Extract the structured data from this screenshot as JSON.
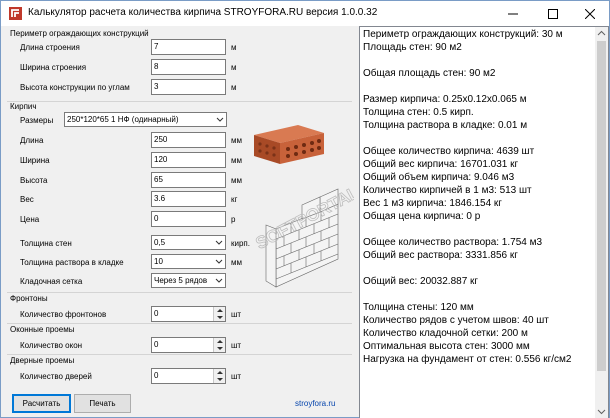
{
  "window": {
    "title": "Калькулятор расчета количества кирпича STROYFORA.RU версия 1.0.0.32"
  },
  "perimeter": {
    "title": "Периметр ограждающих конструкций",
    "fields": [
      {
        "label": "Длина строения",
        "value": "7",
        "unit": "м"
      },
      {
        "label": "Ширина строения",
        "value": "8",
        "unit": "м"
      },
      {
        "label": "Высота конструкции по углам",
        "value": "3",
        "unit": "м"
      }
    ]
  },
  "brick": {
    "title": "Кирпич",
    "size_label": "Размеры",
    "size_value": "250*120*65 1 НФ (одинарный)",
    "fields": [
      {
        "label": "Длина",
        "value": "250",
        "unit": "мм"
      },
      {
        "label": "Ширина",
        "value": "120",
        "unit": "мм"
      },
      {
        "label": "Высота",
        "value": "65",
        "unit": "мм"
      },
      {
        "label": "Вес",
        "value": "3.6",
        "unit": "кг"
      },
      {
        "label": "Цена",
        "value": "0",
        "unit": "р"
      }
    ],
    "wall_thickness": {
      "label": "Толщина стен",
      "value": "0,5",
      "unit": "кирп."
    },
    "mortar_thickness": {
      "label": "Толщина раствора в кладке",
      "value": "10",
      "unit": "мм"
    },
    "mesh": {
      "label": "Кладочная сетка",
      "value": "Через 5 рядов"
    }
  },
  "gables": {
    "title": "Фронтоны",
    "label": "Количество фронтонов",
    "value": "0",
    "unit": "шт"
  },
  "windows": {
    "title": "Оконные проемы",
    "label": "Количество окон",
    "value": "0",
    "unit": "шт"
  },
  "doors": {
    "title": "Дверные проемы",
    "label": "Количество дверей",
    "value": "0",
    "unit": "шт"
  },
  "actions": {
    "calculate": "Расчитать",
    "print": "Печать",
    "site_link": "stroyfora.ru"
  },
  "results": {
    "text": "Периметр ограждающих конструкций: 30 м\nПлощадь стен: 90 м2\n\nОбщая площадь стен: 90 м2\n\nРазмер кирпича: 0.25x0.12x0.065 м\nТолщина стен: 0.5 кирп.\nТолщина раствора в кладке: 0.01 м\n\nОбщее количество кирпича: 4639 шт\nОбщий вес кирпича: 16701.031 кг\nОбщий объем кирпича: 9.046 м3\nКоличество кирпичей в 1 м3: 513 шт\nВес 1 м3 кирпича: 1846.154 кг\nОбщая цена кирпича: 0 р\n\nОбщее количество раствора: 1.754 м3\nОбщий вес раствора: 3331.856 кг\n\nОбщий вес: 20032.887 кг\n\nТолщина стены: 120 мм\nКоличество рядов с учетом швов: 40 шт\nКоличество кладочной сетки: 200 м\nОптимальная высота стен: 3000 мм\nНагрузка на фундамент от стен: 0.556 кг/см2"
  },
  "watermark": {
    "text": "SOFTPORTAL"
  },
  "colors": {
    "brick": "#c8623a",
    "brick_dark": "#8f3d1f",
    "link": "#0645ad",
    "focus": "#0078d7"
  }
}
